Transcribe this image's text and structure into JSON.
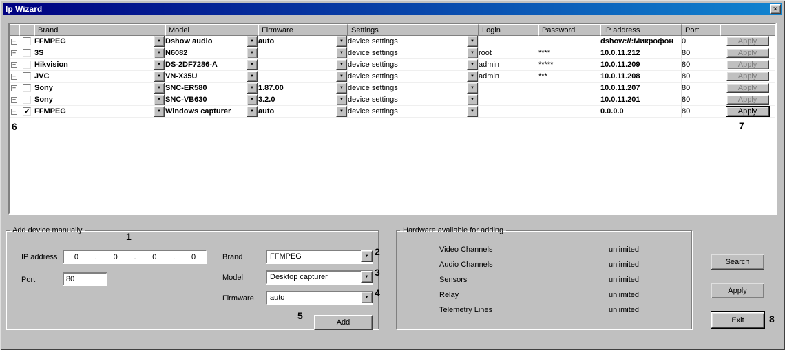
{
  "window": {
    "title": "Ip Wizard",
    "background_color": "#c0c0c0",
    "titlebar_gradient": [
      "#000080",
      "#1084d0"
    ]
  },
  "icons": {
    "close": "✕",
    "dropdown": "▼",
    "expand": "+"
  },
  "table": {
    "headers": [
      "",
      "",
      "Brand",
      "Model",
      "Firmware",
      "Settings",
      "Login",
      "Password",
      "IP address",
      "Port",
      ""
    ],
    "apply_label": "Apply",
    "rows": [
      {
        "checked": false,
        "brand": "FFMPEG",
        "model": "Dshow audio",
        "firmware": "auto",
        "settings": "device settings",
        "login": "",
        "password": "",
        "ip_address": "dshow://:Микрофон",
        "port": "0",
        "apply_focused": false
      },
      {
        "checked": false,
        "brand": "3S",
        "model": "N6082",
        "firmware": "",
        "settings": "device settings",
        "login": "root",
        "password": "****",
        "ip_address": "10.0.11.212",
        "port": "80",
        "apply_focused": false
      },
      {
        "checked": false,
        "brand": "Hikvision",
        "model": "DS-2DF7286-A",
        "firmware": "",
        "settings": "device settings",
        "login": "admin",
        "password": "*****",
        "ip_address": "10.0.11.209",
        "port": "80",
        "apply_focused": false
      },
      {
        "checked": false,
        "brand": "JVC",
        "model": "VN-X35U",
        "firmware": "",
        "settings": "device settings",
        "login": "admin",
        "password": "***",
        "ip_address": "10.0.11.208",
        "port": "80",
        "apply_focused": false
      },
      {
        "checked": false,
        "brand": "Sony",
        "model": "SNC-ER580",
        "firmware": "1.87.00",
        "settings": "device settings",
        "login": "",
        "password": "",
        "ip_address": "10.0.11.207",
        "port": "80",
        "apply_focused": false
      },
      {
        "checked": false,
        "brand": "Sony",
        "model": "SNC-VB630",
        "firmware": "3.2.0",
        "settings": "device settings",
        "login": "",
        "password": "",
        "ip_address": "10.0.11.201",
        "port": "80",
        "apply_focused": false
      },
      {
        "checked": true,
        "brand": "FFMPEG",
        "model": "Windows capturer",
        "firmware": "auto",
        "settings": "device settings",
        "login": "",
        "password": "",
        "ip_address": "0.0.0.0",
        "port": "80",
        "apply_focused": true
      }
    ]
  },
  "add_device": {
    "group_label": "Add device manually",
    "ip_label": "IP address",
    "ip_octets": [
      "0",
      "0",
      "0",
      "0"
    ],
    "port_label": "Port",
    "port_value": "80",
    "brand_label": "Brand",
    "brand_value": "FFMPEG",
    "model_label": "Model",
    "model_value": "Desktop capturer",
    "firmware_label": "Firmware",
    "firmware_value": "auto",
    "add_label": "Add"
  },
  "hardware": {
    "group_label": "Hardware available for adding",
    "items": [
      {
        "label": "Video Channels",
        "value": "unlimited"
      },
      {
        "label": "Audio Channels",
        "value": "unlimited"
      },
      {
        "label": "Sensors",
        "value": "unlimited"
      },
      {
        "label": "Relay",
        "value": "unlimited"
      },
      {
        "label": "Telemetry Lines",
        "value": "unlimited"
      }
    ]
  },
  "actions": {
    "search_label": "Search",
    "apply_label": "Apply",
    "exit_label": "Exit"
  },
  "annotations": [
    "1",
    "2",
    "3",
    "4",
    "5",
    "6",
    "7",
    "8"
  ]
}
